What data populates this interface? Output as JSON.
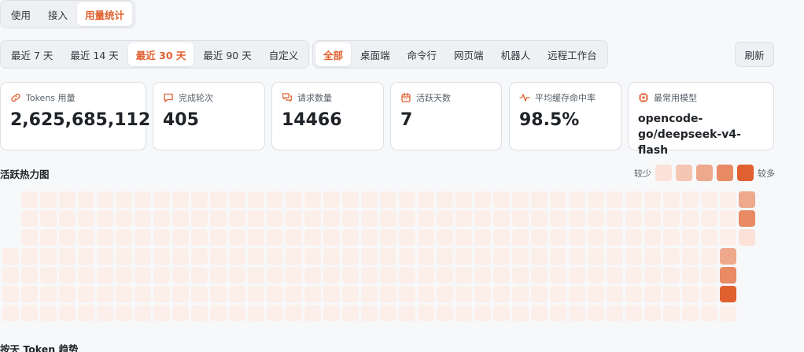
{
  "tabs": [
    {
      "label": "使用",
      "active": false
    },
    {
      "label": "接入",
      "active": false
    },
    {
      "label": "用量统计",
      "active": true
    }
  ],
  "ranges": [
    {
      "label": "最近 7 天",
      "active": false
    },
    {
      "label": "最近 14 天",
      "active": false
    },
    {
      "label": "最近 30 天",
      "active": true
    },
    {
      "label": "最近 90 天",
      "active": false
    },
    {
      "label": "自定义",
      "active": false
    }
  ],
  "clients": [
    {
      "label": "全部",
      "active": true
    },
    {
      "label": "桌面端",
      "active": false
    },
    {
      "label": "命令行",
      "active": false
    },
    {
      "label": "网页端",
      "active": false
    },
    {
      "label": "机器人",
      "active": false
    },
    {
      "label": "远程工作台",
      "active": false
    }
  ],
  "refresh_label": "刷新",
  "stats": [
    {
      "icon": "link-icon",
      "label": "Tokens 用量",
      "value": "2,625,685,112"
    },
    {
      "icon": "chat-bubble-icon",
      "label": "完成轮次",
      "value": "405"
    },
    {
      "icon": "messages-icon",
      "label": "请求数量",
      "value": "14466"
    },
    {
      "icon": "calendar-icon",
      "label": "活跃天数",
      "value": "7"
    },
    {
      "icon": "activity-icon",
      "label": "平均缓存命中率",
      "value": "98.5%"
    },
    {
      "icon": "chip-icon",
      "label": "最常用模型",
      "value": "opencode-go/deepseek-v4-flash"
    }
  ],
  "heatmap": {
    "title": "活跃热力图",
    "legend_less": "较少",
    "legend_more": "较多",
    "colors": [
      "#fcefea",
      "#fbe1d8",
      "#f5c6b3",
      "#eea98d",
      "#e88a64",
      "#e0602f"
    ],
    "days_rows": 7,
    "weeks": 40,
    "first_week_start_row": 3,
    "active_days": [
      {
        "week": 38,
        "row": 3,
        "level": 3
      },
      {
        "week": 38,
        "row": 4,
        "level": 4
      },
      {
        "week": 38,
        "row": 5,
        "level": 5
      },
      {
        "week": 39,
        "row": 0,
        "level": 3
      },
      {
        "week": 39,
        "row": 1,
        "level": 4
      },
      {
        "week": 39,
        "row": 2,
        "level": 1
      }
    ],
    "last_week_rows": 3
  },
  "trend_title": "按天 Token 趋势"
}
